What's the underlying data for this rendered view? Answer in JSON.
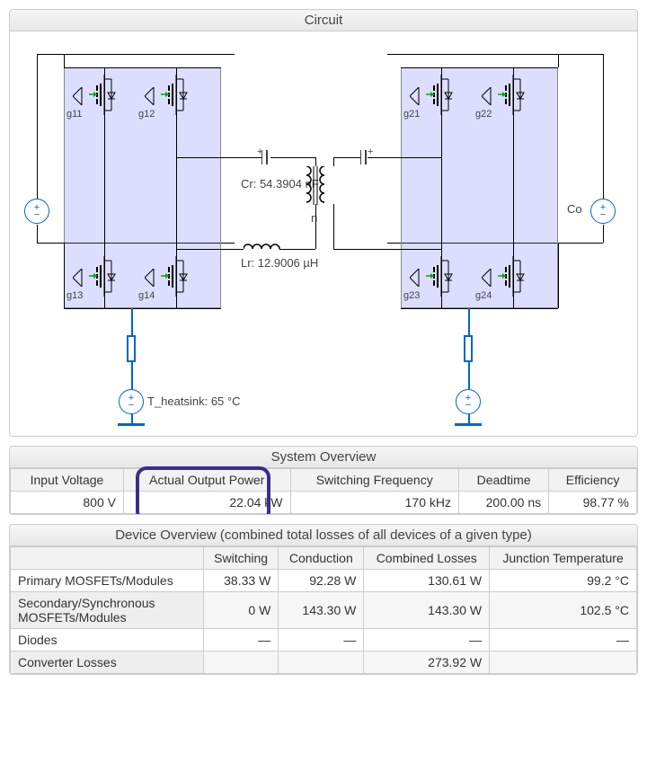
{
  "panels": {
    "circuit_title": "Circuit",
    "system_title": "System Overview",
    "device_title": "Device Overview (combined total losses of all devices of a given type)"
  },
  "circuit": {
    "gates_left": [
      "g11",
      "g12",
      "g13",
      "g14"
    ],
    "gates_right": [
      "g21",
      "g22",
      "g23",
      "g24"
    ],
    "Cr": "Cr: 54.3904 nF",
    "Lr": "Lr: 12.9006 µH",
    "n": "n",
    "Co": "Co",
    "T_heatsink": "T_heatsink: 65 °C"
  },
  "system": {
    "headers": [
      "Input Voltage",
      "Actual Output Power",
      "Switching Frequency",
      "Deadtime",
      "Efficiency"
    ],
    "values": [
      "800 V",
      "22.04 kW",
      "170 kHz",
      "200.00 ns",
      "98.77 %"
    ]
  },
  "device": {
    "col_headers": [
      "",
      "Switching",
      "Conduction",
      "Combined Losses",
      "Junction Temperature"
    ],
    "rows": [
      {
        "label": "Primary MOSFETs/Modules",
        "cells": [
          "38.33 W",
          "92.28 W",
          "130.61 W",
          "99.2 °C"
        ]
      },
      {
        "label": "Secondary/Synchronous MOSFETs/Modules",
        "cells": [
          "0 W",
          "143.30 W",
          "143.30 W",
          "102.5 °C"
        ]
      },
      {
        "label": "Diodes",
        "cells": [
          "—",
          "—",
          "—",
          "—"
        ]
      },
      {
        "label": "Converter Losses",
        "cells": [
          "",
          "",
          "273.92 W",
          ""
        ]
      }
    ]
  }
}
